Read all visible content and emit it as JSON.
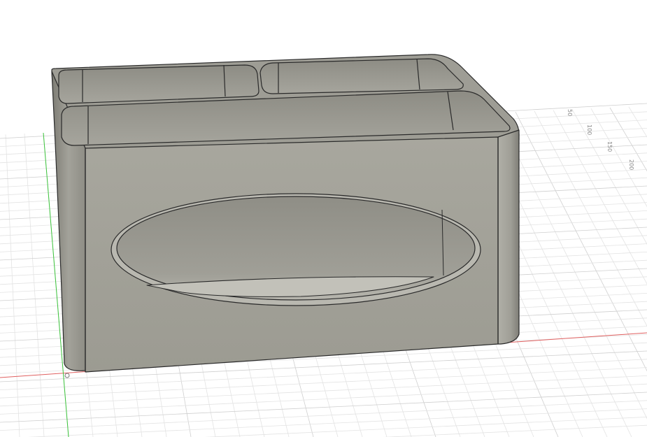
{
  "viewport": {
    "background": "#ffffff",
    "grid_color_minor": "#e3e3e3",
    "grid_color_major": "#cfcfcf",
    "x_axis_color": "#e06060",
    "y_axis_color": "#3cc43c"
  },
  "model": {
    "body_color": "#a09f96",
    "edge_color": "#2a2a2a",
    "compartment_count": 3,
    "front_cutout_shape": "ellipse"
  },
  "grid_labels": [
    "50",
    "100",
    "150",
    "200"
  ]
}
